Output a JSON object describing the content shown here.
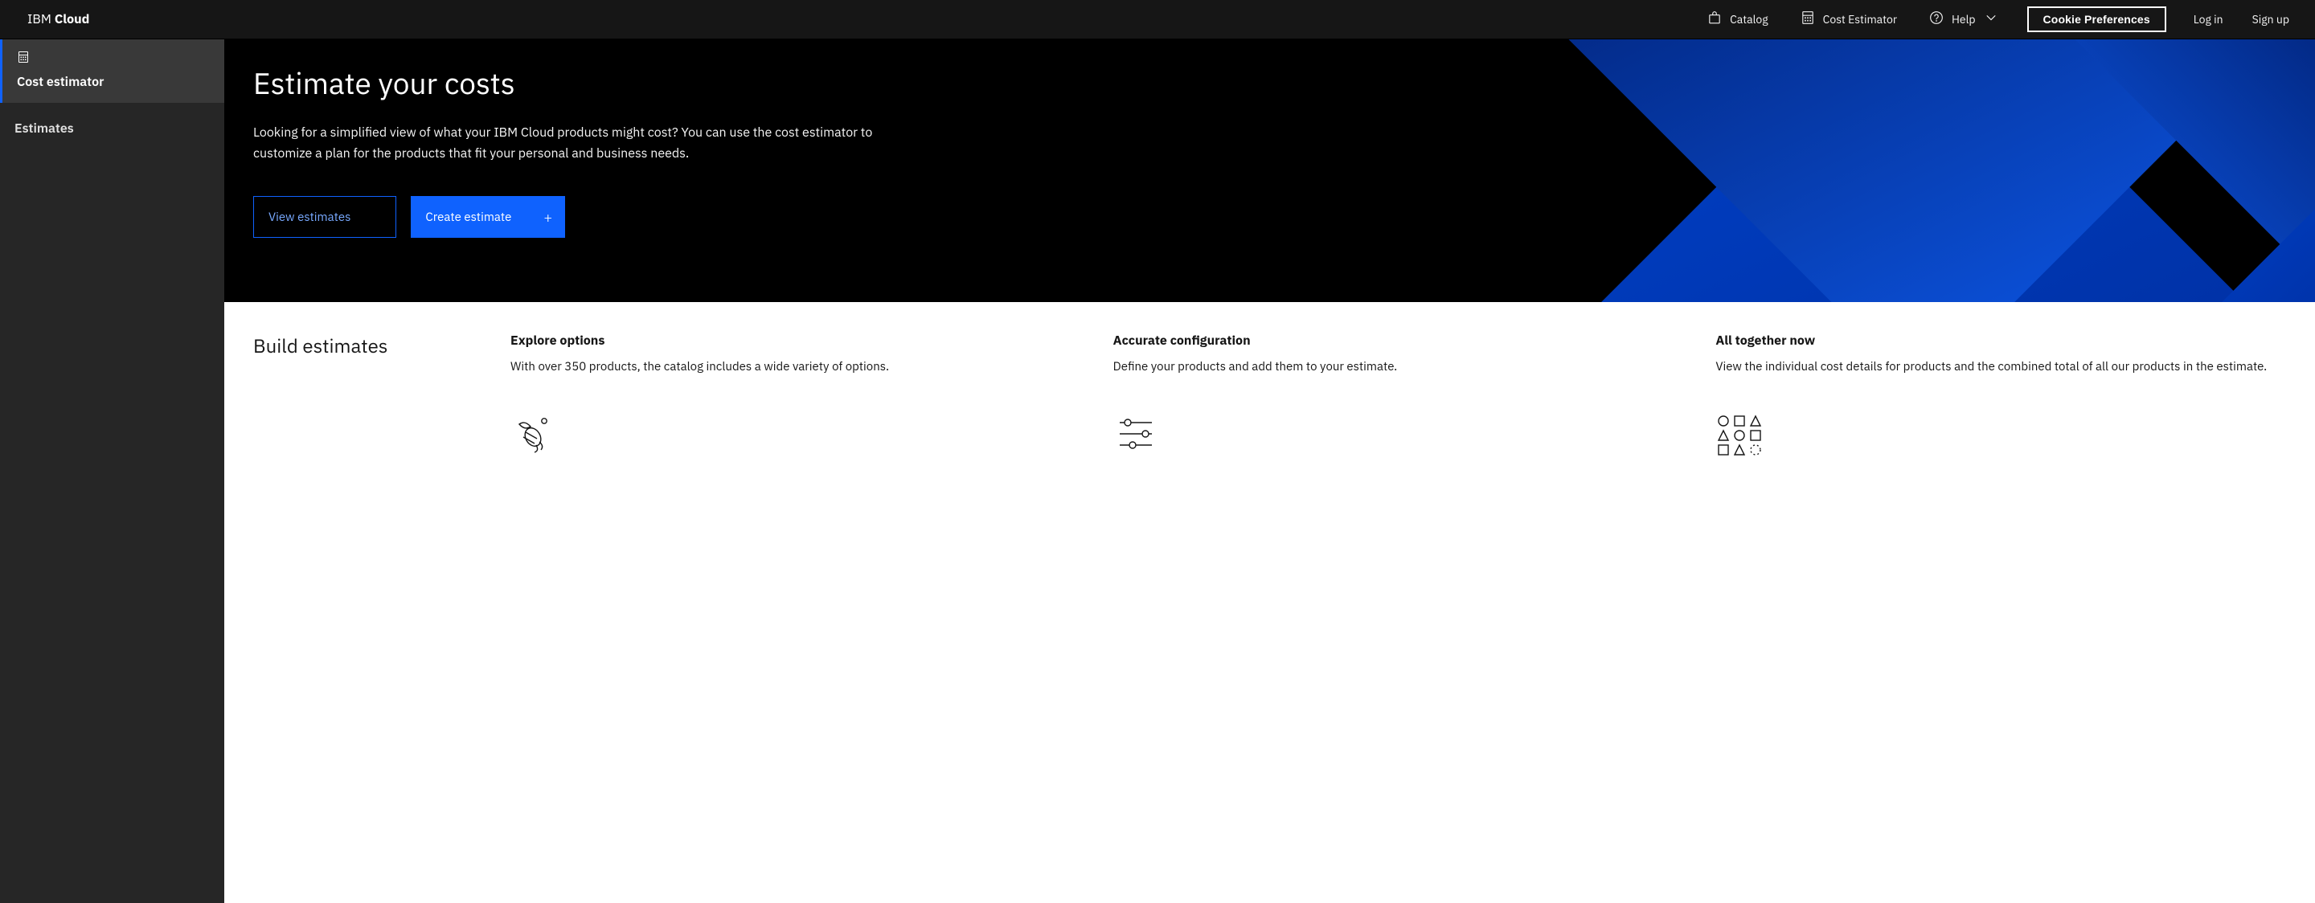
{
  "header": {
    "logo_prefix": "IBM",
    "logo_suffix": "Cloud",
    "catalog_label": "Catalog",
    "cost_estimator_label": "Cost Estimator",
    "help_label": "Help",
    "cookie_btn_label": "Cookie Preferences",
    "login_label": "Log in",
    "signup_label": "Sign up"
  },
  "sidebar": {
    "items": [
      {
        "label": "Cost estimator",
        "active": true
      },
      {
        "label": "Estimates",
        "active": false
      }
    ]
  },
  "hero": {
    "title": "Estimate your costs",
    "description": "Looking for a simplified view of what your IBM Cloud products might cost? You can use the cost estimator to customize a plan for the products that fit your personal and business needs.",
    "view_estimates_btn": "View estimates",
    "create_estimate_btn": "Create estimate"
  },
  "build": {
    "heading": "Build estimates",
    "columns": [
      {
        "title": "Explore options",
        "text": "With over 350 products, the catalog includes a wide variety of options."
      },
      {
        "title": "Accurate configuration",
        "text": "Define your products and add them to your estimate."
      },
      {
        "title": "All together now",
        "text": "View the individual cost details for products and the combined total of all our products in the estimate."
      }
    ]
  },
  "colors": {
    "primary": "#0f62fe",
    "hero_blue_dark": "#001d6c",
    "hero_blue_light": "#0f62fe"
  }
}
